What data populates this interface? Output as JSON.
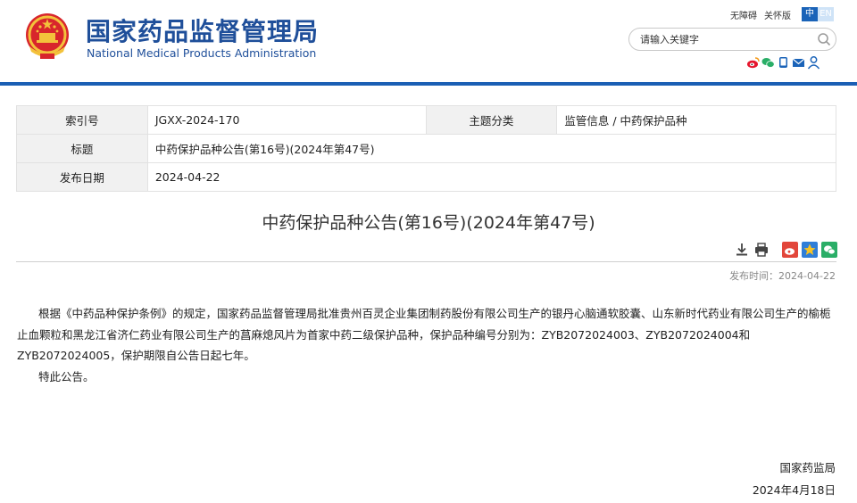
{
  "header": {
    "title_cn": "国家药品监督管理局",
    "title_en": "National Medical Products Administration",
    "links": [
      "无障碍",
      "关怀版"
    ],
    "lang_active": "中",
    "lang_other": "EN",
    "search_placeholder": "请输入关键字"
  },
  "meta": {
    "index_label": "索引号",
    "index_value": "JGXX-2024-170",
    "category_label": "主题分类",
    "category_value": "监管信息 / 中药保护品种",
    "title_label": "标题",
    "title_value": "中药保护品种公告(第16号)(2024年第47号)",
    "date_label": "发布日期",
    "date_value": "2024-04-22"
  },
  "article": {
    "title": "中药保护品种公告(第16号)(2024年第47号)",
    "pub_time": "发布时间：2024-04-22",
    "paragraph1": "根据《中药品种保护条例》的规定，国家药品监督管理局批准贵州百灵企业集团制药股份有限公司生产的银丹心脑通软胶囊、山东新时代药业有限公司生产的榆栀止血颗粒和黑龙江省济仁药业有限公司生产的菖麻熄风片为首家中药二级保护品种，保护品种编号分别为：ZYB2072024003、ZYB2072024004和ZYB2072024005，保护期限自公告日起七年。",
    "paragraph2": "特此公告。",
    "signer": "国家药监局",
    "sign_date": "2024年4月18日"
  },
  "colors": {
    "brand_blue": "#1f4f9a",
    "bar_blue": "#1a5fb4"
  }
}
